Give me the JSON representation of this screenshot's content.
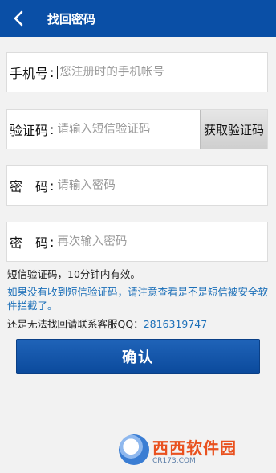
{
  "header": {
    "title": "找回密码",
    "back_icon": "chevron-left-icon"
  },
  "form": {
    "phone": {
      "label": "手机号",
      "colon": ":",
      "placeholder": "您注册时的手机帐号",
      "value": ""
    },
    "code": {
      "label": "验证码",
      "colon": ":",
      "placeholder": "请输入短信验证码",
      "value": "",
      "button_label": "获取验证码"
    },
    "password": {
      "label": "密　码",
      "colon": ":",
      "placeholder": "请输入密码",
      "value": ""
    },
    "confirm_password": {
      "label": "密　码",
      "colon": ":",
      "placeholder": "再次输入密码",
      "value": ""
    }
  },
  "notes": {
    "validity": "短信验证码，10分钟内有效。",
    "not_received": "如果没有收到短信验证码，请注意查看是不是短信被安全软件拦截了。",
    "contact_prefix": "还是无法找回请联系客服QQ：",
    "contact_qq": "2816319747"
  },
  "confirm_button": {
    "label": "确认"
  },
  "watermark": {
    "main": "西西软件园",
    "sub": "CR173.COM"
  },
  "colors": {
    "header_bg": "#0a4fa6",
    "button_bg": "#0b4a9c",
    "link_blue": "#1b6fb8",
    "page_bg": "#f2f2f2"
  }
}
